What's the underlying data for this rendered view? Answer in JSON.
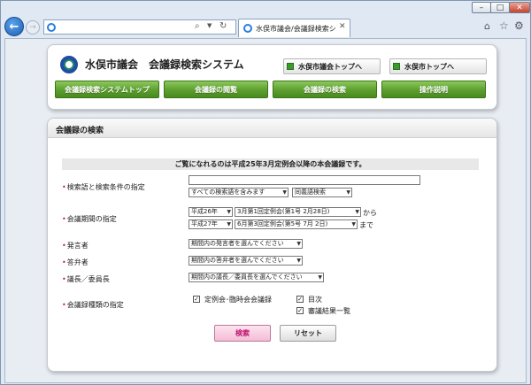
{
  "browser": {
    "address_value": "",
    "tab_title": "水俣市議会/会議録検索シ...",
    "icons": {
      "back": "back-arrow-icon",
      "forward": "forward-arrow-icon",
      "home": "home-icon",
      "favorites": "star-icon",
      "tools": "gear-icon"
    }
  },
  "header": {
    "title": "水俣市議会　会議録検索システム",
    "link_council_top": "水俣市議会トップへ",
    "link_city_top": "水俣市トップへ",
    "nav": {
      "system_top": "会議録検索システムトップ",
      "browse": "会議録の閲覧",
      "search": "会議録の検索",
      "help": "操作説明"
    }
  },
  "search": {
    "heading": "会議録の検索",
    "notice": "ご覧になれるのは平成25年3月定例会以降の本会議録です。",
    "keyword": {
      "label": "検索語と検索条件の指定",
      "value": "",
      "mode_select": "すべての検索語を含みます",
      "synonym_select": "同義語検索"
    },
    "period": {
      "label": "会議期間の指定",
      "from_year": "平成26年",
      "from_meeting": "3月第1回定例会(第1号 2月28日)",
      "from_suffix": "から",
      "to_year": "平成27年",
      "to_meeting": "6月第3回定例会(第5号 7月 2日)",
      "to_suffix": "まで"
    },
    "speaker": {
      "label": "発言者",
      "select": "期間内の発言者を選んでください"
    },
    "answerer": {
      "label": "答弁者",
      "select": "期間内の答弁者を選んでください"
    },
    "chair": {
      "label": "議長／委員長",
      "select": "期間内の議長／委員長を選んでください"
    },
    "record_type": {
      "label": "会議録種類の指定",
      "options": [
        {
          "label": "定例会･臨時会会議録",
          "checked": true
        },
        {
          "label": "目次",
          "checked": true
        },
        {
          "label": "審議結果一覧",
          "checked": true
        }
      ]
    },
    "search_button": "検索",
    "reset_button": "リセット"
  },
  "colors": {
    "nav_green": "#5b9e2e",
    "required_marker": "#d02020",
    "search_button": "#f4bcd6"
  }
}
